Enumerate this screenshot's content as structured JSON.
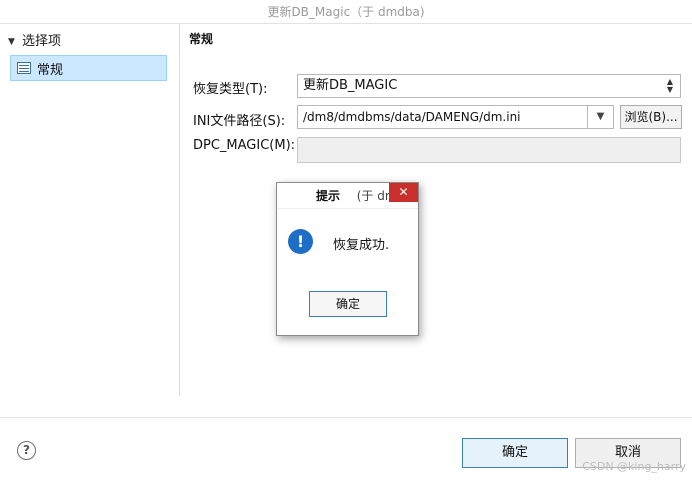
{
  "window": {
    "title": "更新DB_Magic（于 dmdba)"
  },
  "nav": {
    "header": "选择项",
    "items": [
      {
        "label": "常规"
      }
    ]
  },
  "section": {
    "title": "常规"
  },
  "form": {
    "restore_type": {
      "label": "恢复类型(T):",
      "value": "更新DB_MAGIC"
    },
    "ini_path": {
      "label": "INI文件路径(S):",
      "value": "/dm8/dmdbms/data/DAMENG/dm.ini",
      "browse_label": "浏览(B)..."
    },
    "dpc_magic": {
      "label": "DPC_MAGIC(M):",
      "value": ""
    }
  },
  "footer": {
    "help_glyph": "?",
    "ok_label": "确定",
    "cancel_label": "取消",
    "watermark": "CSDN @king_harry"
  },
  "dialog": {
    "title": "提示",
    "title_suffix": "(于 dm",
    "close_glyph": "✕",
    "info_glyph": "!",
    "message": "恢复成功.",
    "ok_label": "确定"
  }
}
